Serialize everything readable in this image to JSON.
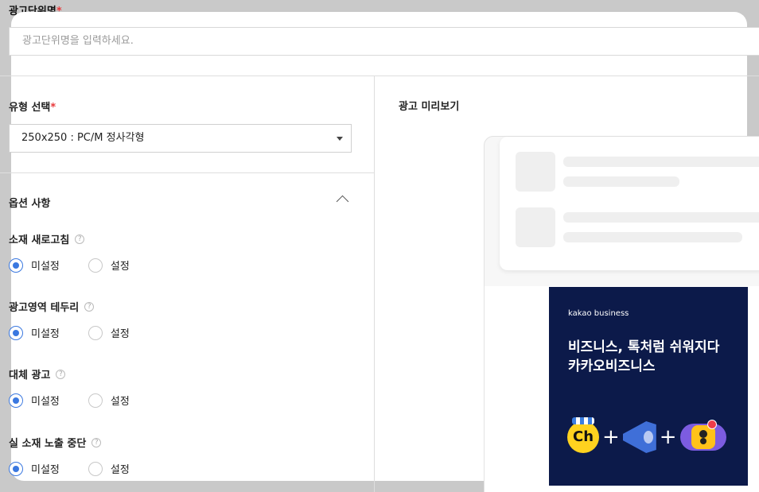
{
  "unit_name": {
    "label": "광고단위명",
    "required_mark": "*",
    "placeholder": "광고단위명을 입력하세요."
  },
  "type_select": {
    "label": "유형 선택",
    "required_mark": "*",
    "value": "250x250 : PC/M 정사각형"
  },
  "options": {
    "title": "옵션 사항",
    "expanded": true,
    "groups": [
      {
        "name": "소재 새로고침",
        "choices": [
          "미설정",
          "설정"
        ],
        "selected": "미설정"
      },
      {
        "name": "광고영역 테두리",
        "choices": [
          "미설정",
          "설정"
        ],
        "selected": "미설정"
      },
      {
        "name": "대체 광고",
        "choices": [
          "미설정",
          "설정"
        ],
        "selected": "미설정"
      },
      {
        "name": "실 소재 노출 중단",
        "choices": [
          "미설정",
          "설정"
        ],
        "selected": "미설정"
      }
    ],
    "help_glyph": "?"
  },
  "preview": {
    "title": "광고 미리보기",
    "ad": {
      "brand": "kakao business",
      "line1": "비즈니스, 톡처럼 쉬워지다",
      "line2": "카카오비즈니스",
      "ch_label": "Ch",
      "plus": "+",
      "background": "#0c1a4a"
    }
  },
  "colors": {
    "accent": "#3a78e0",
    "required": "#e8393b"
  }
}
